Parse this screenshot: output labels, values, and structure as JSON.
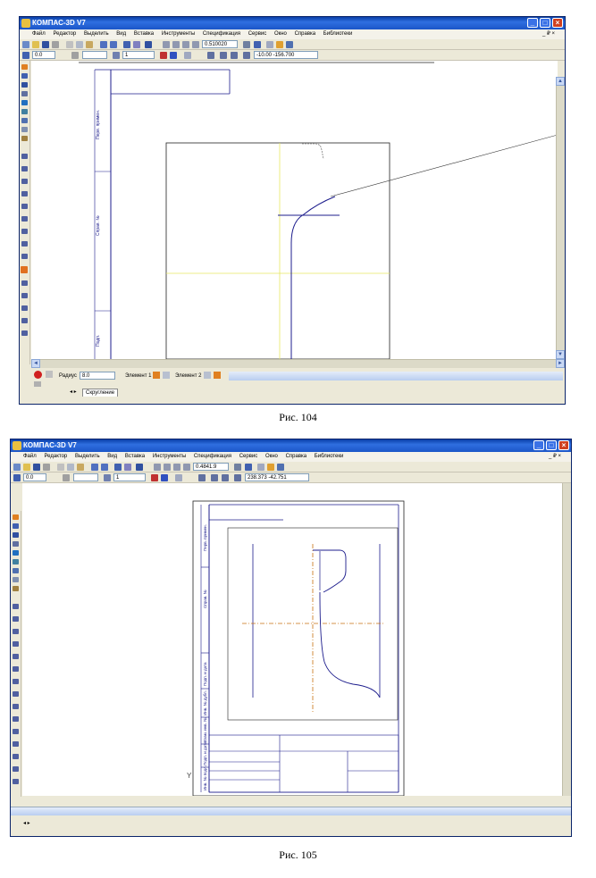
{
  "app_title": "КОМПАС-3D V7",
  "menu_labels": [
    "Файл",
    "Редактор",
    "Выделить",
    "Вид",
    "Вставка",
    "Инструменты",
    "Спецификация",
    "Сервис",
    "Окно",
    "Справка",
    "Библиотеки"
  ],
  "mdi_controls": "_ ₽ ×",
  "fig1": {
    "menu": [
      "Файл",
      "Редактор",
      "Выделить",
      "Вид",
      "Вставка",
      "Инструменты",
      "Спецификация",
      "Сервис",
      "Окно",
      "Справка",
      "Библиотеки"
    ],
    "scale_value": "0.510020",
    "layer_value": "0.0",
    "line_value": "1",
    "coords": "-10.00  -156.700",
    "prop_radius_label": "Радиус",
    "prop_radius_value": "8.0",
    "prop_object1_label": "Элемент 1",
    "prop_object2_label": "Элемент 2",
    "doc_tab": "Скругление",
    "stamp_labels": [
      "Перв. примен.",
      "Справ. №",
      "Подп."
    ],
    "caption": "Рис. 104"
  },
  "fig2": {
    "menu": [
      "Файл",
      "Редактор",
      "Выделить",
      "Вид",
      "Вставка",
      "Инструменты",
      "Спецификация",
      "Сервис",
      "Окно",
      "Справка",
      "Библиотеки"
    ],
    "scale_value": "0.4841.9",
    "layer_value": "0.0",
    "line_value": "1",
    "coords": "238.373  -42.751",
    "stamp_labels": [
      "Перв. примен.",
      "Справ. №",
      "Подп. и дата",
      "Инв. № дубл.",
      "Взам. инв. №",
      "Подп. и дата",
      "Инв. № подл."
    ],
    "caption": "Рис. 105"
  },
  "colors": {
    "title_blue": "#1b55c8",
    "drawing_blue": "#1c1c8c",
    "axis_orange": "#c87010",
    "aux_yellow": "#e8e860",
    "close_red": "#d04020"
  }
}
